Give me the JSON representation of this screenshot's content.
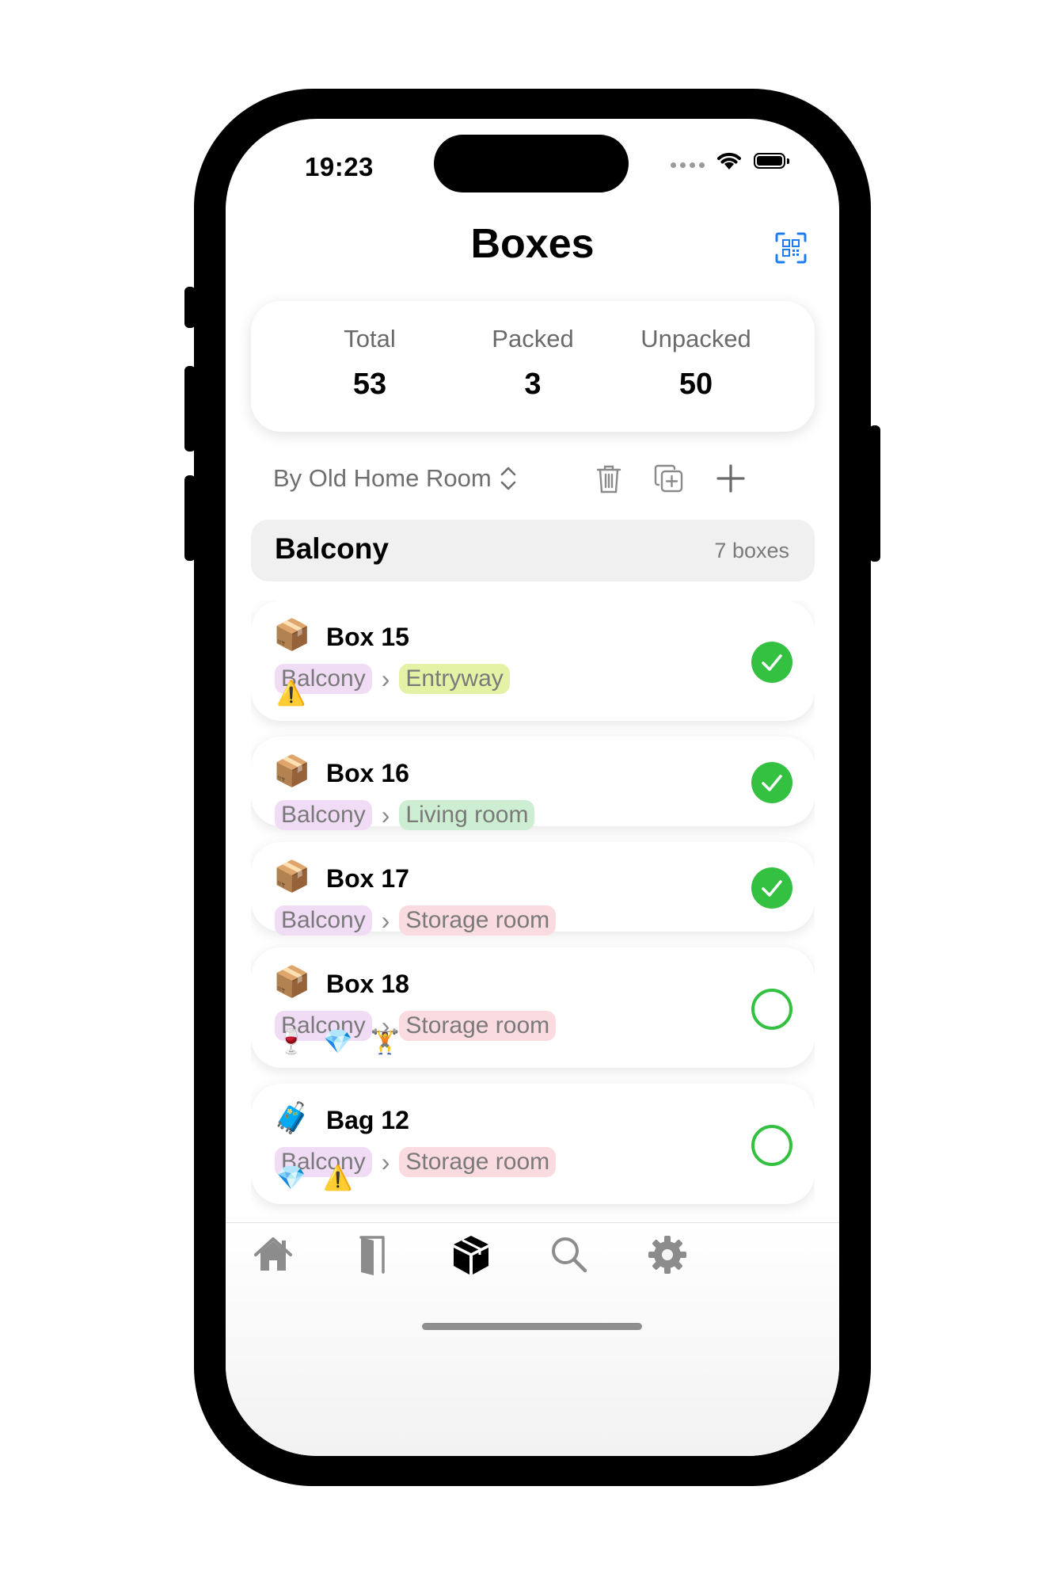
{
  "status_bar": {
    "time": "19:23"
  },
  "header": {
    "title": "Boxes"
  },
  "stats": [
    {
      "label": "Total",
      "value": "53"
    },
    {
      "label": "Packed",
      "value": "3"
    },
    {
      "label": "Unpacked",
      "value": "50"
    }
  ],
  "toolbar": {
    "sort_label": "By Old Home Room"
  },
  "section": {
    "name": "Balcony",
    "count": "7 boxes"
  },
  "boxes": [
    {
      "emoji": "📦",
      "name": "Box 15",
      "from": "Balcony",
      "to": "Entryway",
      "to_color": "#e4f2a6",
      "icons": [
        "⚠️"
      ],
      "packed": true
    },
    {
      "emoji": "📦",
      "name": "Box 16",
      "from": "Balcony",
      "to": "Living room",
      "to_color": "#cdeed3",
      "icons": [],
      "packed": true
    },
    {
      "emoji": "📦",
      "name": "Box 17",
      "from": "Balcony",
      "to": "Storage room",
      "to_color": "#fadbe0",
      "icons": [],
      "packed": true
    },
    {
      "emoji": "📦",
      "name": "Box 18",
      "from": "Balcony",
      "to": "Storage room",
      "to_color": "#fadbe0",
      "icons": [
        "🍷",
        "💎",
        "🏋️"
      ],
      "packed": false
    },
    {
      "emoji": "🧳",
      "name": "Bag 12",
      "from": "Balcony",
      "to": "Storage room",
      "to_color": "#fadbe0",
      "icons": [
        "💎",
        "⚠️"
      ],
      "packed": false
    }
  ],
  "colors": {
    "from_tag": "#f1dcf6",
    "accent_blue": "#1e7cf2",
    "packed_green": "#34c142"
  },
  "tabs": [
    {
      "icon": "home-icon"
    },
    {
      "icon": "door-icon"
    },
    {
      "icon": "box-icon",
      "active": true
    },
    {
      "icon": "search-icon"
    },
    {
      "icon": "gear-icon"
    }
  ]
}
